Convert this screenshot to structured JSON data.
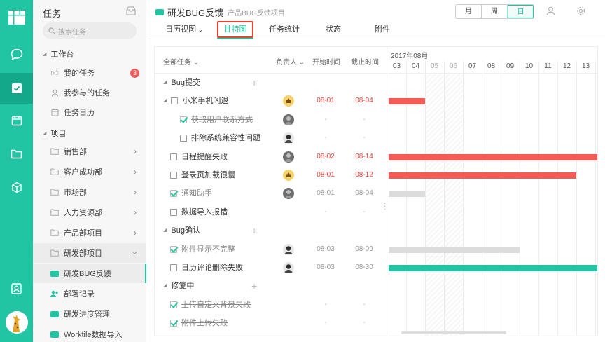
{
  "app": {
    "sidebar_title": "任务",
    "search_placeholder": "搜索任务"
  },
  "sidebar": {
    "workspace_label": "工作台",
    "workspace_items": [
      {
        "label": "我的任务",
        "badge": "3"
      },
      {
        "label": "我参与的任务"
      },
      {
        "label": "任务日历"
      }
    ],
    "projects_label": "项目",
    "project_items": [
      {
        "label": "销售部"
      },
      {
        "label": "客户成功部"
      },
      {
        "label": "市场部"
      },
      {
        "label": "人力资源部"
      },
      {
        "label": "产品部项目"
      },
      {
        "label": "研发部项目"
      }
    ],
    "sub_items": [
      {
        "label": "研发BUG反馈"
      },
      {
        "label": "部署记录"
      },
      {
        "label": "研发进度管理"
      },
      {
        "label": "Worktile数据导入"
      }
    ]
  },
  "header": {
    "project_title": "研发BUG反馈",
    "project_subtitle": "产品BUG反馈项目",
    "view_modes": [
      "月",
      "周",
      "日"
    ],
    "active_view_mode": "日",
    "tabs": [
      "日历视图",
      "甘特图",
      "任务统计",
      "状态",
      "附件"
    ],
    "active_tab": "甘特图"
  },
  "gantt": {
    "columns": {
      "all_tasks": "全部任务",
      "assignee": "负责人",
      "start": "开始时间",
      "end": "截止时间"
    },
    "month_label": "2017年08月",
    "days": [
      "03",
      "04",
      "05",
      "06",
      "07",
      "08",
      "09",
      "10",
      "11",
      "12",
      "13"
    ],
    "weekend_days": [
      "05",
      "06"
    ],
    "rows": [
      {
        "type": "group",
        "name": "Bug提交"
      },
      {
        "type": "task",
        "name": "小米手机闪退",
        "level": 1,
        "done": false,
        "expand": true,
        "avatar": "yellow",
        "start": "08-01",
        "end": "08-04",
        "overdue": true,
        "bar": {
          "from": 3,
          "to": 4,
          "color": "#f55a54"
        }
      },
      {
        "type": "task",
        "name": "获取用户联系方式",
        "level": 2,
        "done": true,
        "avatar": "gray",
        "start": "-",
        "end": "-"
      },
      {
        "type": "task",
        "name": "排除系统兼容性问题",
        "level": 2,
        "done": false,
        "avatar": "bw",
        "start": "-",
        "end": "-"
      },
      {
        "type": "task",
        "name": "日程提醒失败",
        "level": 1,
        "done": false,
        "avatar": "gray",
        "start": "08-02",
        "end": "08-14",
        "overdue": true,
        "bar": {
          "from": 3,
          "to": 14,
          "color": "#f55a54"
        }
      },
      {
        "type": "task",
        "name": "登录页加载很慢",
        "level": 1,
        "done": false,
        "avatar": "yellow",
        "start": "08-01",
        "end": "08-12",
        "overdue": true,
        "bar": {
          "from": 3,
          "to": 12,
          "color": "#f55a54"
        }
      },
      {
        "type": "task",
        "name": "通知助手",
        "level": 1,
        "done": true,
        "avatar": "gray",
        "start": "08-01",
        "end": "08-04",
        "bar": {
          "from": 3,
          "to": 4,
          "color": "#dcdcdc"
        }
      },
      {
        "type": "task",
        "name": "数据导入报错",
        "level": 1,
        "done": false,
        "start": "-",
        "end": "-"
      },
      {
        "type": "group",
        "name": "Bug确认"
      },
      {
        "type": "task",
        "name": "附件显示不完整",
        "level": 1,
        "done": true,
        "avatar": "bw",
        "start": "08-03",
        "end": "08-09",
        "bar": {
          "from": 3,
          "to": 9,
          "color": "#dcdcdc"
        }
      },
      {
        "type": "task",
        "name": "日历评论删除失败",
        "level": 1,
        "done": false,
        "avatar": "bw",
        "start": "08-03",
        "end": "08-30",
        "bar": {
          "from": 3,
          "to": 30,
          "color": "#22c5a3"
        }
      },
      {
        "type": "group",
        "name": "修复中"
      },
      {
        "type": "task",
        "name": "上传自定义背景失败",
        "level": 1,
        "done": true,
        "start": "-",
        "end": "-"
      },
      {
        "type": "task",
        "name": "附件上传失败",
        "level": 1,
        "done": true,
        "start": "-",
        "end": "-"
      }
    ]
  },
  "colors": {
    "accent": "#22c5a3",
    "overdue": "#e8453c",
    "highlight_frame": "#e8432e"
  }
}
